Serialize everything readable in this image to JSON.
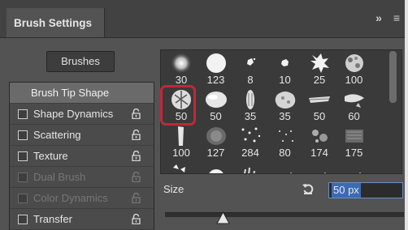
{
  "panel": {
    "title": "Brush Settings",
    "header_icons": [
      {
        "glyph": "»",
        "icon": "expand-panel-icon"
      },
      {
        "glyph": "≡",
        "icon": "panel-menu-icon"
      }
    ]
  },
  "brushes_button": {
    "label": "Brushes"
  },
  "options": [
    {
      "label": "Brush Tip Shape",
      "selected": true,
      "checkbox": false,
      "lock": false,
      "enabled": true
    },
    {
      "label": "Shape Dynamics",
      "selected": false,
      "checkbox": true,
      "lock": true,
      "enabled": true
    },
    {
      "label": "Scattering",
      "selected": false,
      "checkbox": true,
      "lock": true,
      "enabled": true
    },
    {
      "label": "Texture",
      "selected": false,
      "checkbox": true,
      "lock": true,
      "enabled": true
    },
    {
      "label": "Dual Brush",
      "selected": false,
      "checkbox": true,
      "lock": true,
      "enabled": false
    },
    {
      "label": "Color Dynamics",
      "selected": false,
      "checkbox": true,
      "lock": true,
      "enabled": false
    },
    {
      "label": "Transfer",
      "selected": false,
      "checkbox": true,
      "lock": true,
      "enabled": true
    }
  ],
  "brush_presets": [
    {
      "size": "30",
      "shape": "soft-round"
    },
    {
      "size": "123",
      "shape": "hard-round"
    },
    {
      "size": "8",
      "shape": "splat-small"
    },
    {
      "size": "10",
      "shape": "blob-small"
    },
    {
      "size": "25",
      "shape": "spatter"
    },
    {
      "size": "100",
      "shape": "chalk"
    },
    {
      "size": "50",
      "shape": "scatter-leaves",
      "selected": true
    },
    {
      "size": "50",
      "shape": "oval-soft"
    },
    {
      "size": "35",
      "shape": "grain-vertical"
    },
    {
      "size": "35",
      "shape": "sponge"
    },
    {
      "size": "50",
      "shape": "dry-brush"
    },
    {
      "size": "60",
      "shape": "smudge"
    },
    {
      "size": "100",
      "shape": "bristle"
    },
    {
      "size": "127",
      "shape": "rough-oval"
    },
    {
      "size": "284",
      "shape": "dots"
    },
    {
      "size": "80",
      "shape": "speckle"
    },
    {
      "size": "174",
      "shape": "stipple"
    },
    {
      "size": "175",
      "shape": "texture"
    },
    {
      "size": "",
      "shape": "flakes"
    },
    {
      "size": "",
      "shape": "round"
    },
    {
      "size": "",
      "shape": "grass"
    },
    {
      "size": "",
      "shape": "spray"
    },
    {
      "size": "",
      "shape": "spray"
    },
    {
      "size": "",
      "shape": "spray"
    }
  ],
  "size_control": {
    "label": "Size",
    "value": "50 px",
    "reset_icon": "reset-arrow-icon",
    "slider_fraction": 0.23
  },
  "colors": {
    "panel_bg": "#535353",
    "selected_row": "#6a6a6a",
    "highlight_ring": "#c1273a",
    "input_selection": "#3d6ab5"
  }
}
